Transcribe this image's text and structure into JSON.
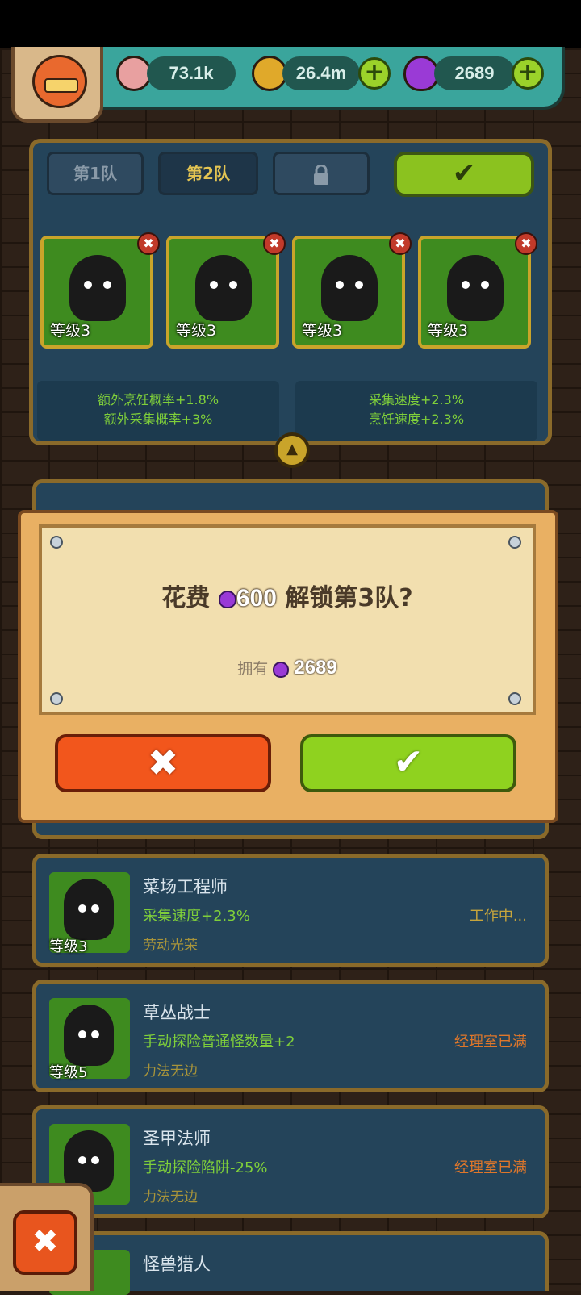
{
  "resources": {
    "eyes": "73.1k",
    "coins": "26.4m",
    "potions": "2689"
  },
  "team_tabs": [
    {
      "label": "第1队"
    },
    {
      "label": "第2队"
    }
  ],
  "team_members": [
    {
      "level": "等级3"
    },
    {
      "level": "等级3"
    },
    {
      "level": "等级3"
    },
    {
      "level": "等级3"
    }
  ],
  "bonuses": {
    "left_line1": "额外烹饪概率+1.8%",
    "left_line2": "额外采集概率+3%",
    "right_line1": "采集速度+2.3%",
    "right_line2": "烹饪速度+2.3%"
  },
  "dialog": {
    "prefix": "花费",
    "cost": "600",
    "suffix": "解锁第3队?",
    "owned_label": "拥有",
    "owned_value": "2689"
  },
  "list": [
    {
      "name": "菜场工程师",
      "effect": "采集速度+2.3%",
      "trait": "劳动光荣",
      "status": "工作中...",
      "level": "等级3"
    },
    {
      "name": "草丛战士",
      "effect": "手动探险普通怪数量+2",
      "trait": "力法无边",
      "status": "经理室已满",
      "level": "等级5"
    },
    {
      "name": "圣甲法师",
      "effect": "手动探险陷阱-25%",
      "trait": "力法无边",
      "status": "经理室已满",
      "level": ""
    },
    {
      "name": "怪兽猎人",
      "effect": "",
      "trait": "",
      "status": "",
      "level": ""
    }
  ],
  "icons": {
    "check": "✔",
    "close": "✖",
    "plus": "+",
    "lock": "lock-icon",
    "collapse": "▲"
  },
  "colors": {
    "confirm_green": "#8fd21f",
    "cancel_orange": "#f2561c",
    "effect_green": "#7fcf3a",
    "status_orange": "#e0772a"
  }
}
